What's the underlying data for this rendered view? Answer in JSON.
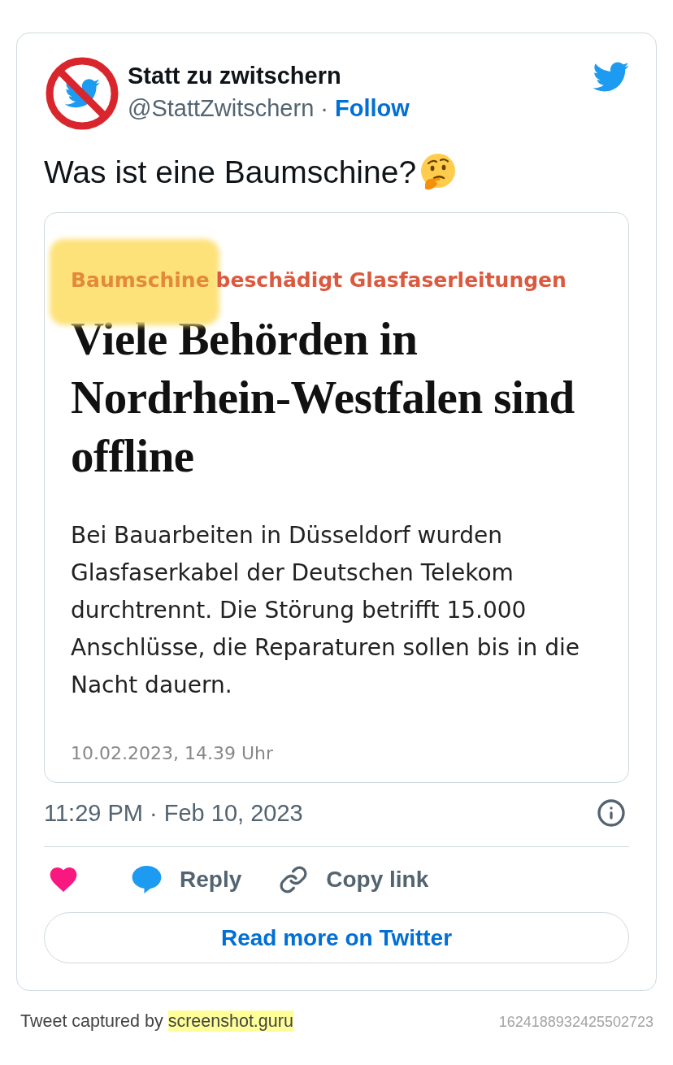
{
  "author": {
    "name": "Statt zu zwitschern",
    "handle": "@StattZwitschern",
    "separator": "·",
    "follow_label": "Follow"
  },
  "tweet": {
    "text": "Was ist eine Baumschine?"
  },
  "embedded_article": {
    "kicker": [
      {
        "text": "Baumschine",
        "highlighted": true
      },
      {
        "text": "beschädigt Glasfaserleitungen",
        "highlighted": false
      }
    ],
    "headline": "Viele Behörden in Nordrhein-Westfalen sind offline",
    "body": "Bei Bauarbeiten in Düsseldorf wurden Glasfaserkabel der Deutschen Telekom durchtrennt. Die Störung betrifft 15.000 Anschlüsse, die Reparaturen sollen bis in die Nacht dauern.",
    "date": "10.02.2023, 14.39 Uhr"
  },
  "timestamp": "11:29 PM · Feb 10, 2023",
  "actions": [
    {
      "kind": "like"
    },
    {
      "kind": "reply",
      "label": "Reply"
    },
    {
      "kind": "copy_link",
      "label": "Copy link"
    }
  ],
  "read_more_button": "Read more on Twitter",
  "footer": {
    "credit": "Tweet captured by",
    "site": "screenshot.guru",
    "tweet_id": "1624188932425502723"
  }
}
